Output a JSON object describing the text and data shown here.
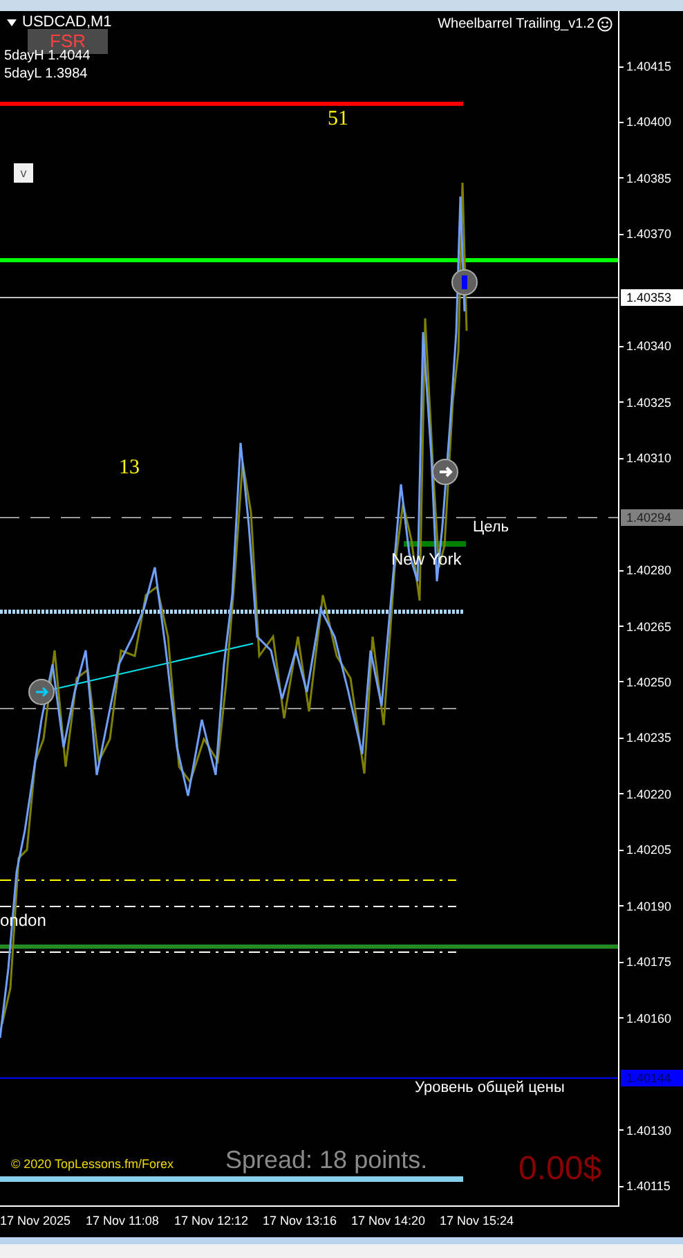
{
  "chart": {
    "symbol": "USDCAD,M1",
    "fsr_label": "FSR",
    "info_lines": [
      "5dayH 1.4044",
      "5dayL 1.3984"
    ],
    "expert": {
      "name": "Wheelbarrel Trailing_v1.2"
    },
    "toggle": {
      "label": "v"
    },
    "annotations": [
      {
        "kind": "number",
        "text": "51"
      },
      {
        "kind": "number",
        "text": "13"
      },
      {
        "kind": "label",
        "text": "Цель"
      },
      {
        "kind": "session",
        "text": "New York"
      },
      {
        "kind": "session",
        "text": "ondon"
      },
      {
        "kind": "label",
        "text": "Уровень общей цены"
      }
    ],
    "copyright": "© 2020 TopLessons.fm/Forex",
    "spread": "Spread: 18 points.",
    "profit": "0.00$"
  },
  "price_axis": {
    "ticks": [
      "1.40415",
      "1.40400",
      "1.40385",
      "1.40370",
      "1.40340",
      "1.40325",
      "1.40310",
      "1.40280",
      "1.40265",
      "1.40250",
      "1.40235",
      "1.40220",
      "1.40205",
      "1.40190",
      "1.40175",
      "1.40160",
      "1.40130",
      "1.40115"
    ],
    "markers": [
      {
        "text": "1.40353",
        "color": "#ffffff"
      },
      {
        "text": "1.40294",
        "color": "#808080"
      },
      {
        "text": "1.40144",
        "color": "#0000ff"
      }
    ]
  },
  "time_axis": {
    "labels": [
      "17 Nov 2025",
      "17 Nov 11:08",
      "17 Nov 12:12",
      "17 Nov 13:16",
      "17 Nov 14:20",
      "17 Nov 15:24"
    ]
  }
}
